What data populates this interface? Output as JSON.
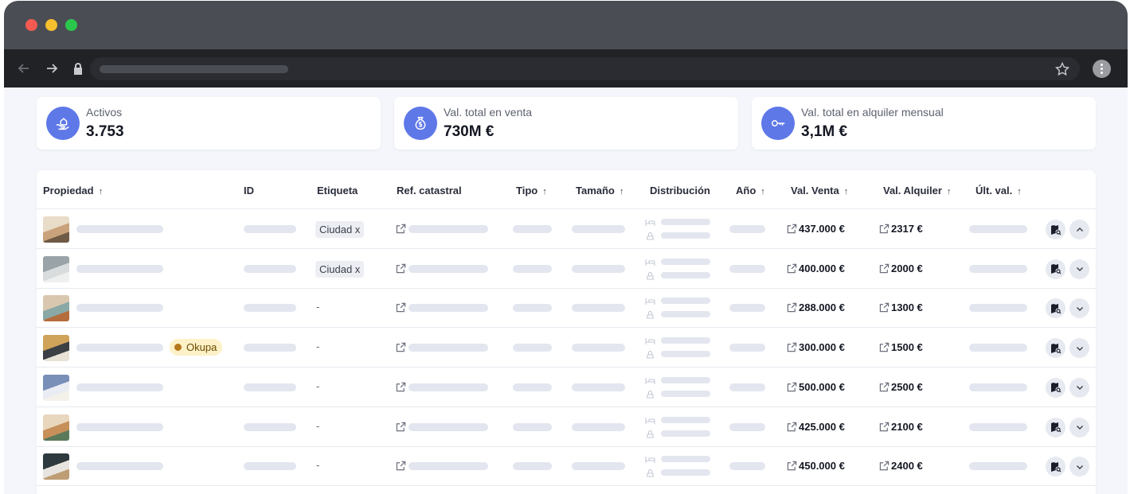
{
  "kpis": [
    {
      "label": "Activos",
      "value": "3.753",
      "icon": "hand-house-icon"
    },
    {
      "label": "Val. total en venta",
      "value": "730M €",
      "icon": "money-bag-icon"
    },
    {
      "label": "Val. total en alquiler mensual",
      "value": "3,1M €",
      "icon": "key-icon"
    }
  ],
  "table": {
    "headers": {
      "propiedad": "Propiedad",
      "id": "ID",
      "etiqueta": "Etiqueta",
      "ref": "Ref. catastral",
      "tipo": "Tipo",
      "tamano": "Tamaño",
      "distribucion": "Distribución",
      "ano": "Año",
      "venta": "Val. Venta",
      "alquiler": "Val. Alquiler",
      "ultval": "Últ. val.",
      "sort_arrow": "↑"
    },
    "rows": [
      {
        "tag": "Ciudad x",
        "badge": "",
        "venta": "437.000 €",
        "alquiler": "2317 €",
        "expanded": true
      },
      {
        "tag": "Ciudad x",
        "badge": "",
        "venta": "400.000 €",
        "alquiler": "2000 €",
        "expanded": false
      },
      {
        "tag": "-",
        "badge": "",
        "venta": "288.000 €",
        "alquiler": "1300 €",
        "expanded": false
      },
      {
        "tag": "-",
        "badge": "Okupa",
        "venta": "300.000 €",
        "alquiler": "1500 €",
        "expanded": false
      },
      {
        "tag": "-",
        "badge": "",
        "venta": "500.000 €",
        "alquiler": "2500 €",
        "expanded": false
      },
      {
        "tag": "-",
        "badge": "",
        "venta": "425.000 €",
        "alquiler": "2100 €",
        "expanded": false
      },
      {
        "tag": "-",
        "badge": "",
        "venta": "450.000 €",
        "alquiler": "2400 €",
        "expanded": false
      }
    ]
  },
  "colors": {
    "accent": "#5e78e8",
    "badge_bg": "#fdf1c7",
    "skeleton": "#e3e6ef"
  }
}
